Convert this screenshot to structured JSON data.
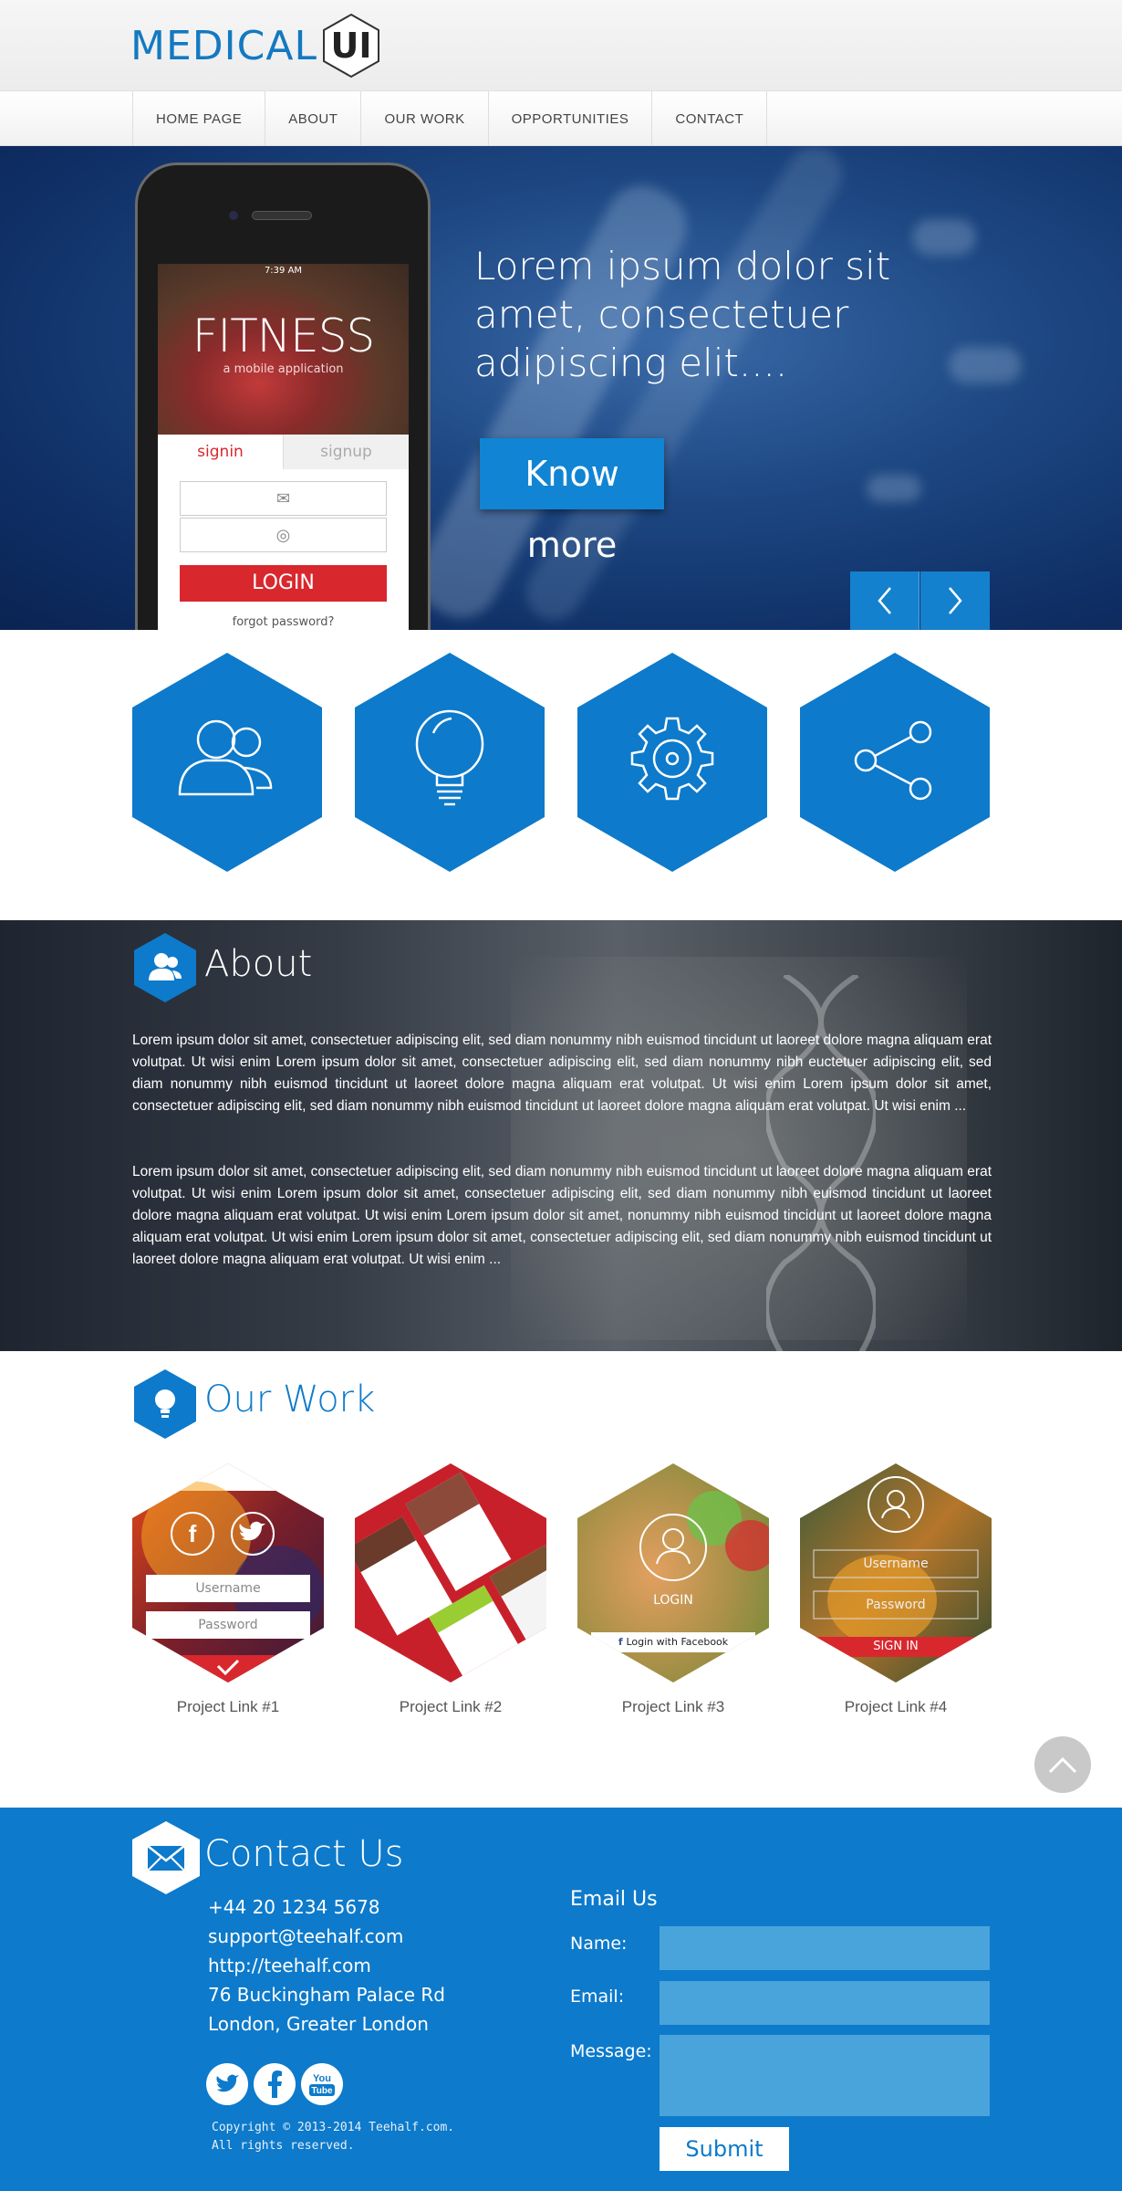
{
  "logo": {
    "text": "MEDICAL",
    "badge": "UI"
  },
  "nav": {
    "items": [
      "HOME PAGE",
      "ABOUT",
      "OUR WORK",
      "OPPORTUNITIES",
      "CONTACT"
    ]
  },
  "hero": {
    "headline": "Lorem ipsum dolor sit amet, consectetuer adipiscing elit....",
    "button": "Know more",
    "phone": {
      "time": "7:39 AM",
      "title": "FITNESS",
      "subtitle": "a mobile application",
      "tab_signin": "signin",
      "tab_signup": "signup",
      "login": "LOGIN",
      "forgot": "forgot password?"
    }
  },
  "features": [
    "users-icon",
    "lightbulb-icon",
    "gear-icon",
    "share-icon"
  ],
  "about": {
    "title": "About",
    "p1": "Lorem ipsum dolor sit amet, consectetuer adipiscing elit, sed diam nonummy nibh euismod tincidunt ut laoreet dolore magna aliquam erat volutpat. Ut wisi enim Lorem ipsum dolor sit amet, consectetuer adipiscing elit, sed diam nonummy nibh euctetuer adipiscing elit, sed diam nonummy nibh euismod tincidunt ut laoreet dolore magna aliquam erat volutpat. Ut wisi enim Lorem ipsum dolor sit amet, consectetuer adipiscing elit, sed diam nonummy nibh euismod tincidunt ut laoreet dolore magna aliquam erat volutpat. Ut wisi enim ...",
    "p2": "Lorem ipsum dolor sit amet, consectetuer adipiscing elit, sed diam nonummy nibh euismod tincidunt ut laoreet dolore magna aliquam erat volutpat. Ut wisi enim Lorem ipsum dolor sit amet, consectetuer adipiscing elit, sed diam nonummy nibh euismod tincidunt ut laoreet dolore magna aliquam erat volutpat. Ut wisi enim Lorem ipsum dolor sit amet, nonummy nibh euismod tincidunt ut laoreet dolore magna aliquam erat volutpat. Ut wisi enim Lorem ipsum dolor sit amet, consectetuer adipiscing elit, sed diam nonummy nibh euismod tincidunt ut laoreet dolore magna aliquam erat volutpat. Ut wisi enim ..."
  },
  "work": {
    "title": "Our Work",
    "login_caption": "LOGIN",
    "projects": [
      {
        "label": "Project Link #1",
        "username": "Username",
        "password": "Password"
      },
      {
        "label": "Project Link #2"
      },
      {
        "label": "Project Link #3",
        "login": "LOGIN",
        "facebook": "Login with Facebook"
      },
      {
        "label": "Project Link #4",
        "username": "Username",
        "password": "Password",
        "signin": "SIGN IN"
      }
    ]
  },
  "contact": {
    "title": "Contact Us",
    "phone": "+44 20 1234 5678",
    "email": "support@teehalf.com",
    "web": "http://teehalf.com",
    "address1": "76 Buckingham Palace Rd",
    "address2": "London, Greater London",
    "copyright1": "Copyright © 2013-2014 Teehalf.com.",
    "copyright2": "All rights reserved.",
    "form_title": "Email Us",
    "name_label": "Name:",
    "email_label": "Email:",
    "message_label": "Message:",
    "submit": "Submit"
  },
  "colors": {
    "brand_blue": "#0d7acb",
    "accent_red": "#d9272e"
  }
}
